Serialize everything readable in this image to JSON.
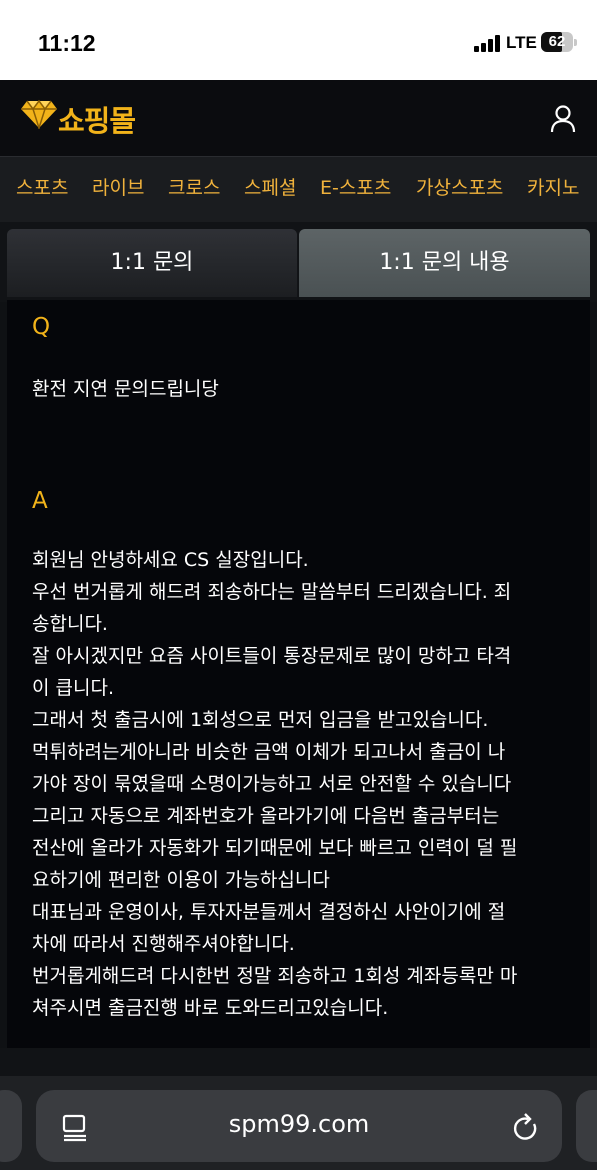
{
  "status": {
    "time": "11:12",
    "network": "LTE",
    "battery": "62"
  },
  "header": {
    "logo_text": "쇼핑몰"
  },
  "nav": [
    "스포츠",
    "라이브",
    "크로스",
    "스페셜",
    "E-스포츠",
    "가상스포츠",
    "카지노"
  ],
  "tabs": [
    {
      "label": "1:1 문의",
      "active": false
    },
    {
      "label": "1:1 문의 내용",
      "active": true
    }
  ],
  "qa": {
    "q_label": "Q",
    "question": "환전 지연 문의드립니당",
    "a_label": "A",
    "answer_lines": [
      "회원님 안녕하세요 CS 실장입니다.",
      "우선 번거롭게 해드려 죄송하다는 말씀부터 드리겠습니다. 죄",
      "송합니다.",
      "잘 아시겠지만 요즘 사이트들이 통장문제로 많이 망하고 타격",
      "이 큽니다.",
      "그래서 첫 출금시에 1회성으로 먼저 입금을 받고있습니다.",
      "먹튀하려는게아니라 비슷한 금액 이체가 되고나서 출금이 나",
      "가야 장이 묶였을때 소명이가능하고 서로 안전할 수 있습니다",
      "그리고 자동으로 계좌번호가 올라가기에 다음번 출금부터는",
      "전산에 올라가 자동화가 되기때문에 보다 빠르고 인력이 덜 필",
      "요하기에 편리한 이용이 가능하십니다",
      "대표님과 운영이사, 투자자분들께서 결정하신 사안이기에 절",
      "차에 따라서 진행해주셔야합니다.",
      "번거롭게해드려 다시한번 정말 죄송하고 1회성 계좌등록만 마",
      "쳐주시면 출금진행 바로 도와드리고있습니다."
    ]
  },
  "browser": {
    "url": "spm99.com"
  },
  "colors": {
    "accent": "#f2b31a",
    "nav_text": "#f0b23c",
    "active_tab": "#555c5e"
  }
}
